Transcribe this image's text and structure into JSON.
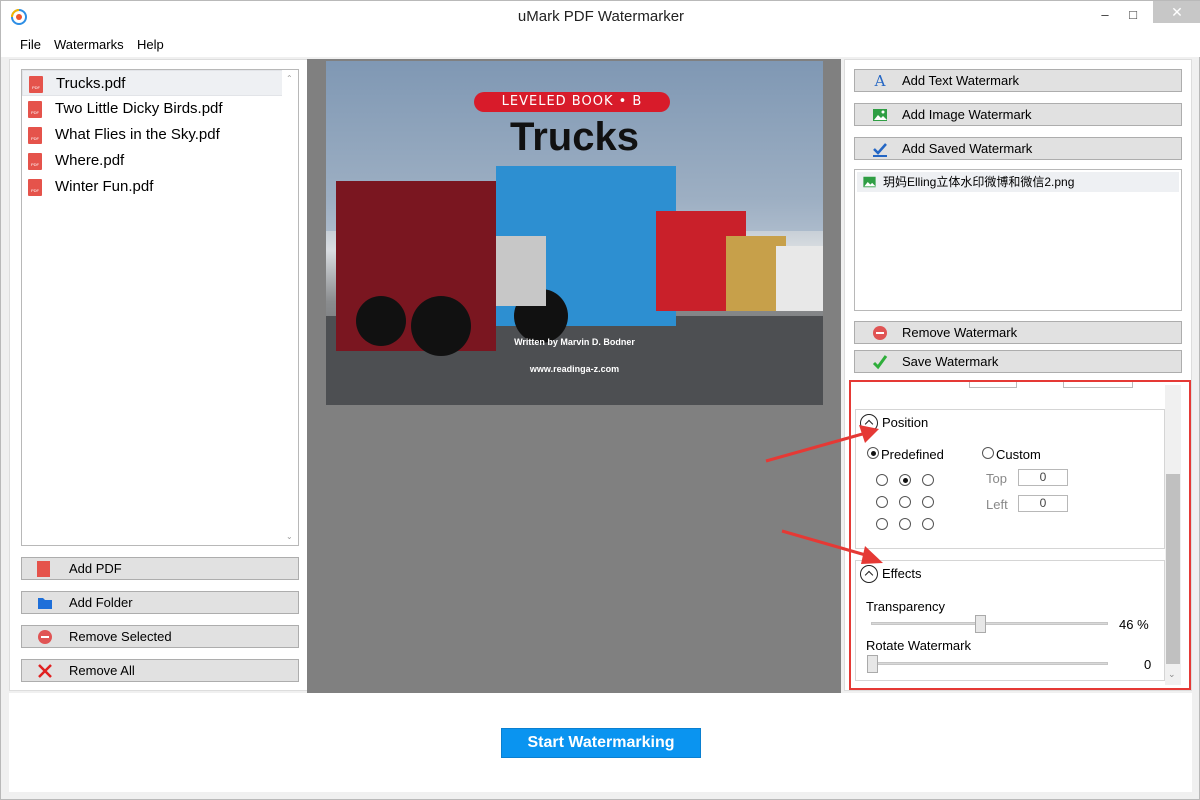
{
  "window": {
    "title": "uMark PDF Watermarker"
  },
  "menu": [
    "File",
    "Watermarks",
    "Help"
  ],
  "files": [
    "Trucks.pdf",
    "Two Little Dicky Birds.pdf",
    "What Flies in the Sky.pdf",
    "Where.pdf",
    "Winter Fun.pdf"
  ],
  "left_buttons": {
    "add_pdf": "Add PDF",
    "add_folder": "Add Folder",
    "remove_selected": "Remove Selected",
    "remove_all": "Remove All"
  },
  "preview": {
    "banner": "LEVELED BOOK • B",
    "title": "Trucks",
    "author": "Written by Marvin D. Bodner",
    "url": "www.readinga-z.com"
  },
  "right_buttons": {
    "add_text": "Add Text Watermark",
    "add_image": "Add Image Watermark",
    "add_saved": "Add Saved Watermark",
    "remove": "Remove Watermark",
    "save": "Save Watermark"
  },
  "watermarks": [
    "玥妈Elling立体水印微博和微信2.png"
  ],
  "position": {
    "heading": "Position",
    "predefined_label": "Predefined",
    "custom_label": "Custom",
    "selected": "predefined",
    "grid_selected_index": 1,
    "top_label": "Top",
    "top_value": "0",
    "left_label": "Left",
    "left_value": "0"
  },
  "effects": {
    "heading": "Effects",
    "transparency_label": "Transparency",
    "transparency_value": "46 %",
    "transparency_fraction": 0.46,
    "rotate_label": "Rotate Watermark",
    "rotate_value": "0",
    "rotate_fraction": 0.0
  },
  "start_button": "Start Watermarking",
  "colors": {
    "accent": "#0a94f0",
    "highlight": "#e53935",
    "preview_bg": "#808080"
  }
}
